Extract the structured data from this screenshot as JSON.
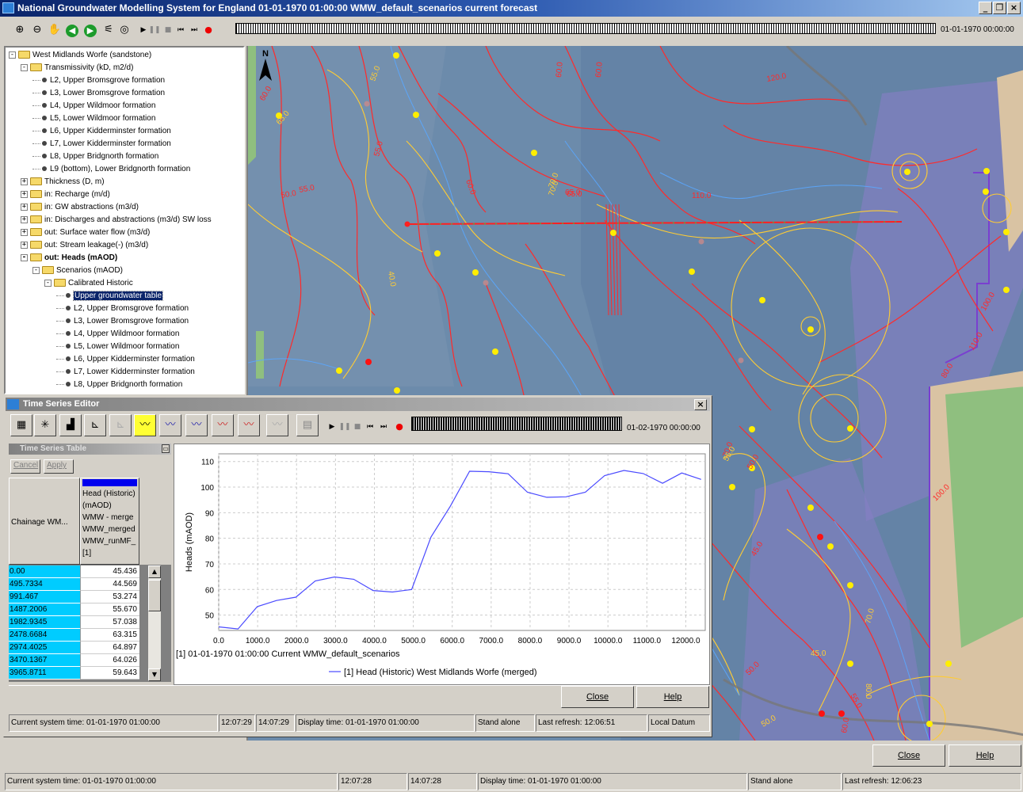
{
  "window": {
    "title": "National Groundwater Modelling System for England 01-01-1970 01:00:00 WMW_default_scenarios current forecast",
    "time_display": "01-01-1970 00:00:00"
  },
  "tree": {
    "items": [
      {
        "label": "West Midlands Worfe (sandstone)",
        "level": 0,
        "type": "folder",
        "exp": "-"
      },
      {
        "label": "Transmissivity (kD, m2/d)",
        "level": 1,
        "type": "folder",
        "exp": "-"
      },
      {
        "label": "L2, Upper Bromsgrove formation",
        "level": 2,
        "type": "leaf"
      },
      {
        "label": "L3,  Lower Bromsgrove formation",
        "level": 2,
        "type": "leaf"
      },
      {
        "label": "L4, Upper Wildmoor formation",
        "level": 2,
        "type": "leaf"
      },
      {
        "label": "L5, Lower Wildmoor formation",
        "level": 2,
        "type": "leaf"
      },
      {
        "label": "L6, Upper Kidderminster formation",
        "level": 2,
        "type": "leaf"
      },
      {
        "label": "L7, Lower Kidderminster formation",
        "level": 2,
        "type": "leaf"
      },
      {
        "label": "L8, Upper Bridgnorth formation",
        "level": 2,
        "type": "leaf"
      },
      {
        "label": "L9 (bottom), Lower Bridgnorth formation",
        "level": 2,
        "type": "leaf"
      },
      {
        "label": "Thickness (D, m)",
        "level": 1,
        "type": "folder",
        "exp": "+"
      },
      {
        "label": "in: Recharge (m/d)",
        "level": 1,
        "type": "folder",
        "exp": "+"
      },
      {
        "label": "in: GW abstractions (m3/d)",
        "level": 1,
        "type": "folder",
        "exp": "+"
      },
      {
        "label": "in: Discharges and abstractions (m3/d) SW loss",
        "level": 1,
        "type": "folder",
        "exp": "+"
      },
      {
        "label": "out: Surface water flow (m3/d)",
        "level": 1,
        "type": "folder",
        "exp": "+"
      },
      {
        "label": "out: Stream leakage(-) (m3/d)",
        "level": 1,
        "type": "folder",
        "exp": "+"
      },
      {
        "label": "out: Heads (mAOD)",
        "level": 1,
        "type": "folder",
        "exp": "-",
        "bold": true
      },
      {
        "label": "Scenarios (mAOD)",
        "level": 2,
        "type": "folder",
        "exp": "-"
      },
      {
        "label": "Calibrated Historic",
        "level": 3,
        "type": "folder",
        "exp": "-"
      },
      {
        "label": "Upper groundwater table",
        "level": 4,
        "type": "leaf",
        "selected": true
      },
      {
        "label": "L2, Upper Bromsgrove formation",
        "level": 4,
        "type": "leaf"
      },
      {
        "label": "L3, Lower Bromsgrove formation",
        "level": 4,
        "type": "leaf"
      },
      {
        "label": "L4, Upper Wildmoor formation",
        "level": 4,
        "type": "leaf"
      },
      {
        "label": "L5, Lower Wildmoor formation",
        "level": 4,
        "type": "leaf"
      },
      {
        "label": "L6, Upper Kidderminster formation",
        "level": 4,
        "type": "leaf"
      },
      {
        "label": "L7, Lower Kidderminster formation",
        "level": 4,
        "type": "leaf"
      },
      {
        "label": "L8, Upper Bridgnorth formation",
        "level": 4,
        "type": "leaf"
      }
    ]
  },
  "map": {
    "north_label": "N",
    "contour_labels": [
      "55.0",
      "60.0",
      "65.0",
      "55.0",
      "50.0",
      "55.0",
      "60.0",
      "70.0",
      "65.0",
      "110.0",
      "120.0",
      "60.0",
      "40.0",
      "60.0",
      "70.0",
      "65.0",
      "70.0",
      "55.0",
      "50.0",
      "45.0",
      "50.0",
      "70.0",
      "80.0",
      "100.0",
      "110.0",
      "100.0",
      "80.0",
      "50.0",
      "45.0",
      "55.0",
      "60.0"
    ]
  },
  "tse": {
    "title": "Time Series Editor",
    "time_display": "01-02-1970 00:00:00",
    "table_title": "Time Series Table",
    "cancel_label": "Cancel",
    "apply_label": "Apply",
    "col1_header": "Chainage WM...",
    "col2_header": [
      "Head (Historic)",
      "(mAOD)",
      "WMW - merge",
      "WMW_merged",
      "WMW_runMF_",
      "[1]"
    ],
    "rows": [
      {
        "chainage": "0.00",
        "head": "45.436"
      },
      {
        "chainage": "495.7334",
        "head": "44.569"
      },
      {
        "chainage": "991.467",
        "head": "53.274"
      },
      {
        "chainage": "1487.2006",
        "head": "55.670"
      },
      {
        "chainage": "1982.9345",
        "head": "57.038"
      },
      {
        "chainage": "2478.6684",
        "head": "63.315"
      },
      {
        "chainage": "2974.4025",
        "head": "64.897"
      },
      {
        "chainage": "3470.1367",
        "head": "64.026"
      },
      {
        "chainage": "3965.8711",
        "head": "59.643"
      }
    ],
    "chart_caption": "[1] 01-01-1970 01:00:00 Current WMW_default_scenarios",
    "legend_label": "[1] Head (Historic) West Midlands Worfe (merged)",
    "close_label": "Close",
    "help_label": "Help",
    "status": {
      "system_time": "Current system time: 01-01-1970 01:00:00",
      "t1": "12:07:29",
      "t2": "14:07:29",
      "display_time": "Display time: 01-01-1970 01:00:00",
      "mode": "Stand alone",
      "refresh": "Last refresh: 12:06:51",
      "datum": "Local Datum"
    }
  },
  "chart_data": {
    "type": "line",
    "title": "",
    "xlabel": "",
    "ylabel": "Heads (mAOD)",
    "xlim": [
      0,
      12500
    ],
    "ylim": [
      44,
      113
    ],
    "xticks": [
      0,
      1000,
      2000,
      3000,
      4000,
      5000,
      6000,
      7000,
      8000,
      9000,
      10000,
      11000,
      12000
    ],
    "xtick_labels": [
      "0.0",
      "1000.0",
      "2000.0",
      "3000.0",
      "4000.0",
      "5000.0",
      "6000.0",
      "7000.0",
      "8000.0",
      "9000.0",
      "10000.0",
      "11000.0",
      "12000.0"
    ],
    "yticks": [
      50,
      60,
      70,
      80,
      90,
      100,
      110
    ],
    "ytick_labels": [
      "50",
      "60",
      "70",
      "80",
      "90",
      "100",
      "110"
    ],
    "grid": true,
    "legend": "bottom",
    "series": [
      {
        "name": "[1] Head (Historic) West Midlands Worfe (merged)",
        "color": "#4a4aff",
        "x": [
          0,
          496,
          991,
          1487,
          1983,
          2479,
          2974,
          3470,
          3966,
          4462,
          4957,
          5453,
          5949,
          6445,
          6940,
          7436,
          7932,
          8428,
          8923,
          9419,
          9915,
          10411,
          10906,
          11402,
          11898,
          12394
        ],
        "y": [
          45.4,
          44.6,
          53.3,
          55.7,
          57.0,
          63.3,
          64.9,
          64.0,
          59.6,
          59.0,
          60.0,
          80.5,
          92.5,
          106.2,
          106.0,
          105.2,
          98.0,
          96.0,
          96.2,
          98.0,
          104.5,
          106.5,
          105.3,
          101.5,
          105.5,
          103.0
        ]
      }
    ]
  },
  "main_buttons": {
    "close_label": "Close",
    "help_label": "Help"
  },
  "status": {
    "system_time": "Current system time: 01-01-1970 01:00:00",
    "t1": "12:07:28",
    "t2": "14:07:28",
    "display_time": "Display time: 01-01-1970 01:00:00",
    "mode": "Stand alone",
    "refresh": "Last refresh: 12:06:23"
  },
  "colors": {
    "title_bar": "#0a246a",
    "selection": "#0a246a",
    "chart_line": "#4a4aff",
    "table_key": "#00ccff",
    "toggle_on": "#ffff33"
  }
}
